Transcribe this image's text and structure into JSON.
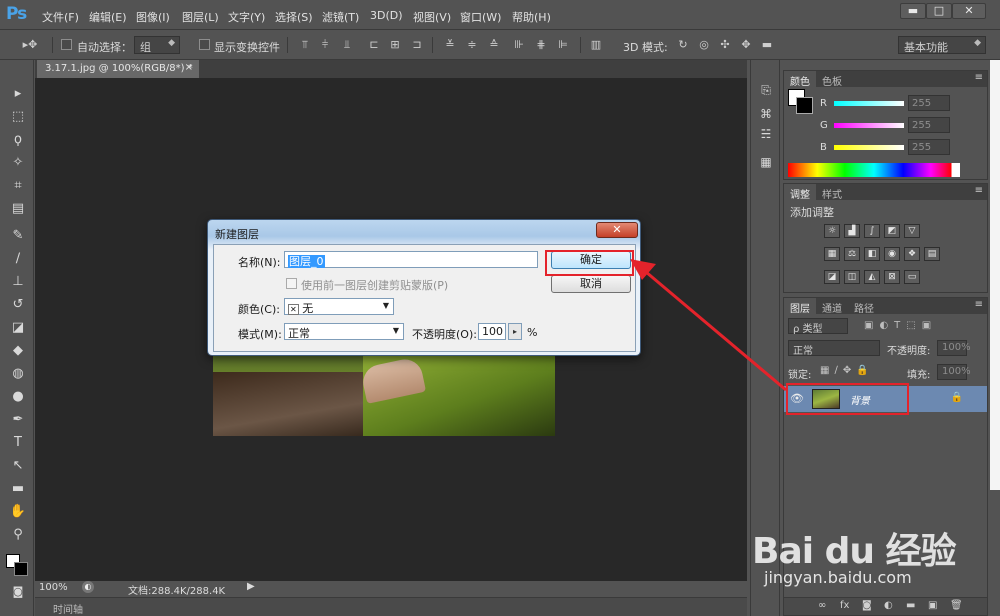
{
  "app": {
    "logo": "Ps"
  },
  "menu": [
    "文件(F)",
    "编辑(E)",
    "图像(I)",
    "图层(L)",
    "文字(Y)",
    "选择(S)",
    "滤镜(T)",
    "3D(D)",
    "视图(V)",
    "窗口(W)",
    "帮助(H)"
  ],
  "window_buttons": {
    "minimize": "▬",
    "maximize": "□",
    "close": "✕"
  },
  "options": {
    "auto_select_label": "自动选择：",
    "auto_select_value": "组",
    "show_transform_label": "显示变换控件",
    "mode_3d_label": "3D 模式:",
    "workspace": "基本功能"
  },
  "document": {
    "tab_title": "3.17.1.jpg @ 100%(RGB/8*) *",
    "tab_close": "×",
    "zoom": "100%",
    "doc_info": "文档:288.4K/288.4K",
    "timeline": "时间轴"
  },
  "color_panel": {
    "tabs": [
      "颜色",
      "色板"
    ],
    "channels": [
      {
        "label": "R",
        "value": "255",
        "color": "#00e5ff"
      },
      {
        "label": "G",
        "value": "255",
        "color": "#ff00ff"
      },
      {
        "label": "B",
        "value": "255",
        "color": "#ffff00"
      }
    ]
  },
  "adjust_panel": {
    "tabs": [
      "调整",
      "样式"
    ],
    "title": "添加调整"
  },
  "layers_panel": {
    "tabs": [
      "图层",
      "通道",
      "路径"
    ],
    "filter": "ρ 类型",
    "blend_mode": "正常",
    "opacity_label": "不透明度:",
    "opacity_value": "100%",
    "lock_label": "锁定:",
    "fill_label": "填充:",
    "fill_value": "100%",
    "layer_name": "背景"
  },
  "dialog": {
    "title": "新建图层",
    "name_label": "名称(N):",
    "name_value": "图层_0",
    "clip_label": "使用前一图层创建剪贴蒙版(P)",
    "color_label": "颜色(C):",
    "color_value": "无",
    "color_icon": "✕",
    "mode_label": "模式(M):",
    "mode_value": "正常",
    "opacity_label": "不透明度(O):",
    "opacity_value": "100",
    "opacity_unit": "%",
    "ok": "确定",
    "cancel": "取消",
    "close": "✕"
  },
  "watermark": {
    "brand": "Bai du 经验",
    "url": "jingyan.baidu.com"
  },
  "accent": {
    "highlight_red": "#e4232b",
    "selection_blue": "#3399ff",
    "layer_selected": "#6c89b1"
  }
}
